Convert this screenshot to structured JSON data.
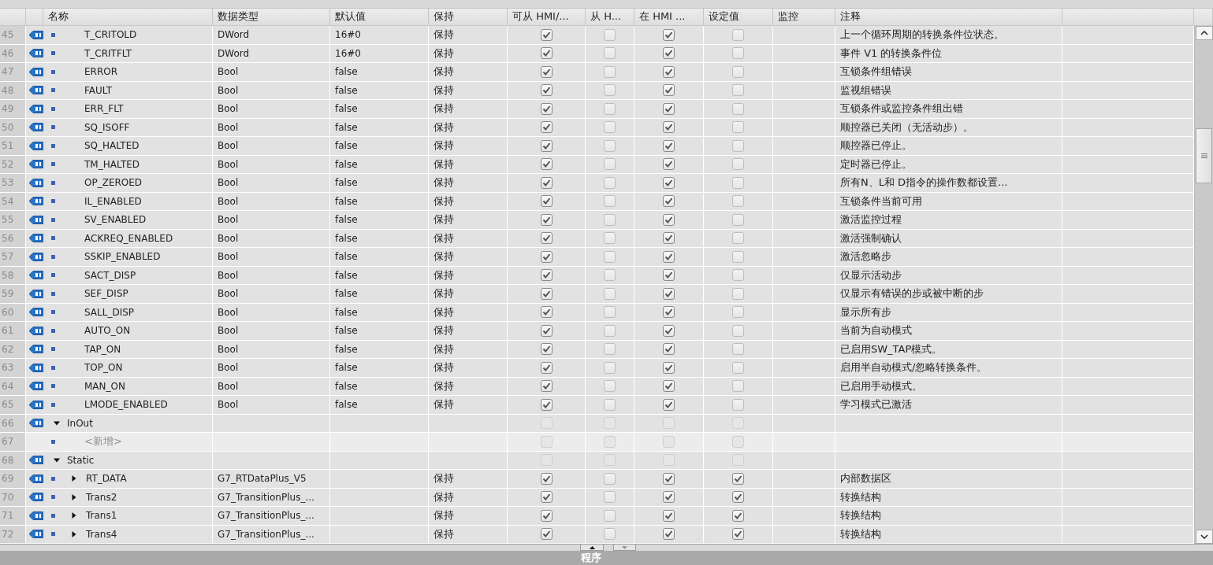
{
  "columns": [
    "名称",
    "数据类型",
    "默认值",
    "保持",
    "可从 HMI/...",
    "从 H...",
    "在 HMI ...",
    "设定值",
    "监控",
    "注释"
  ],
  "rows": [
    {
      "num": "45",
      "kind": "member",
      "name": "T_CRITOLD",
      "type": "DWord",
      "default": "16#0",
      "retain": "保持",
      "checks": [
        true,
        false,
        true,
        false
      ],
      "disabled": false,
      "comment": "上一个循环周期的转换条件位状态。"
    },
    {
      "num": "46",
      "kind": "member",
      "name": "T_CRITFLT",
      "type": "DWord",
      "default": "16#0",
      "retain": "保持",
      "checks": [
        true,
        false,
        true,
        false
      ],
      "disabled": false,
      "comment": "事件 V1 的转换条件位"
    },
    {
      "num": "47",
      "kind": "member",
      "name": "ERROR",
      "type": "Bool",
      "default": "false",
      "retain": "保持",
      "checks": [
        true,
        false,
        true,
        false
      ],
      "disabled": false,
      "comment": "互锁条件组错误"
    },
    {
      "num": "48",
      "kind": "member",
      "name": "FAULT",
      "type": "Bool",
      "default": "false",
      "retain": "保持",
      "checks": [
        true,
        false,
        true,
        false
      ],
      "disabled": false,
      "comment": "监视组错误"
    },
    {
      "num": "49",
      "kind": "member",
      "name": "ERR_FLT",
      "type": "Bool",
      "default": "false",
      "retain": "保持",
      "checks": [
        true,
        false,
        true,
        false
      ],
      "disabled": false,
      "comment": "互锁条件或监控条件组出错"
    },
    {
      "num": "50",
      "kind": "member",
      "name": "SQ_ISOFF",
      "type": "Bool",
      "default": "false",
      "retain": "保持",
      "checks": [
        true,
        false,
        true,
        false
      ],
      "disabled": false,
      "comment": "顺控器已关闭（无活动步）。"
    },
    {
      "num": "51",
      "kind": "member",
      "name": "SQ_HALTED",
      "type": "Bool",
      "default": "false",
      "retain": "保持",
      "checks": [
        true,
        false,
        true,
        false
      ],
      "disabled": false,
      "comment": "顺控器已停止。"
    },
    {
      "num": "52",
      "kind": "member",
      "name": "TM_HALTED",
      "type": "Bool",
      "default": "false",
      "retain": "保持",
      "checks": [
        true,
        false,
        true,
        false
      ],
      "disabled": false,
      "comment": "定时器已停止。"
    },
    {
      "num": "53",
      "kind": "member",
      "name": "OP_ZEROED",
      "type": "Bool",
      "default": "false",
      "retain": "保持",
      "checks": [
        true,
        false,
        true,
        false
      ],
      "disabled": false,
      "comment": "所有N、L和 D指令的操作数都设置..."
    },
    {
      "num": "54",
      "kind": "member",
      "name": "IL_ENABLED",
      "type": "Bool",
      "default": "false",
      "retain": "保持",
      "checks": [
        true,
        false,
        true,
        false
      ],
      "disabled": false,
      "comment": "互锁条件当前可用"
    },
    {
      "num": "55",
      "kind": "member",
      "name": "SV_ENABLED",
      "type": "Bool",
      "default": "false",
      "retain": "保持",
      "checks": [
        true,
        false,
        true,
        false
      ],
      "disabled": false,
      "comment": "激活监控过程"
    },
    {
      "num": "56",
      "kind": "member",
      "name": "ACKREQ_ENABLED",
      "type": "Bool",
      "default": "false",
      "retain": "保持",
      "checks": [
        true,
        false,
        true,
        false
      ],
      "disabled": false,
      "comment": "激活强制确认"
    },
    {
      "num": "57",
      "kind": "member",
      "name": "SSKIP_ENABLED",
      "type": "Bool",
      "default": "false",
      "retain": "保持",
      "checks": [
        true,
        false,
        true,
        false
      ],
      "disabled": false,
      "comment": "激活忽略步"
    },
    {
      "num": "58",
      "kind": "member",
      "name": "SACT_DISP",
      "type": "Bool",
      "default": "false",
      "retain": "保持",
      "checks": [
        true,
        false,
        true,
        false
      ],
      "disabled": false,
      "comment": "仅显示活动步"
    },
    {
      "num": "59",
      "kind": "member",
      "name": "SEF_DISP",
      "type": "Bool",
      "default": "false",
      "retain": "保持",
      "checks": [
        true,
        false,
        true,
        false
      ],
      "disabled": false,
      "comment": "仅显示有错误的步或被中断的步"
    },
    {
      "num": "60",
      "kind": "member",
      "name": "SALL_DISP",
      "type": "Bool",
      "default": "false",
      "retain": "保持",
      "checks": [
        true,
        false,
        true,
        false
      ],
      "disabled": false,
      "comment": "显示所有步"
    },
    {
      "num": "61",
      "kind": "member",
      "name": "AUTO_ON",
      "type": "Bool",
      "default": "false",
      "retain": "保持",
      "checks": [
        true,
        false,
        true,
        false
      ],
      "disabled": false,
      "comment": "当前为自动模式"
    },
    {
      "num": "62",
      "kind": "member",
      "name": "TAP_ON",
      "type": "Bool",
      "default": "false",
      "retain": "保持",
      "checks": [
        true,
        false,
        true,
        false
      ],
      "disabled": false,
      "comment": "已启用SW_TAP模式。"
    },
    {
      "num": "63",
      "kind": "member",
      "name": "TOP_ON",
      "type": "Bool",
      "default": "false",
      "retain": "保持",
      "checks": [
        true,
        false,
        true,
        false
      ],
      "disabled": false,
      "comment": "启用半自动模式/忽略转换条件。"
    },
    {
      "num": "64",
      "kind": "member",
      "name": "MAN_ON",
      "type": "Bool",
      "default": "false",
      "retain": "保持",
      "checks": [
        true,
        false,
        true,
        false
      ],
      "disabled": false,
      "comment": "已启用手动模式。"
    },
    {
      "num": "65",
      "kind": "member",
      "name": "LMODE_ENABLED",
      "type": "Bool",
      "default": "false",
      "retain": "保持",
      "checks": [
        true,
        false,
        true,
        false
      ],
      "disabled": false,
      "comment": "学习模式已激活"
    },
    {
      "num": "66",
      "kind": "section",
      "name": "InOut",
      "expanded": true,
      "checks": [
        false,
        false,
        false,
        false
      ],
      "disabled": true
    },
    {
      "num": "67",
      "kind": "add",
      "name": "<新增>",
      "checks": [
        false,
        false,
        false,
        false
      ],
      "disabled": true
    },
    {
      "num": "68",
      "kind": "section",
      "name": "Static",
      "expanded": true,
      "checks": [
        false,
        false,
        false,
        false
      ],
      "disabled": true
    },
    {
      "num": "69",
      "kind": "member",
      "expanded": false,
      "name": "RT_DATA",
      "type": "G7_RTDataPlus_V5",
      "retain": "保持",
      "checks": [
        true,
        false,
        true,
        true
      ],
      "disabled": false,
      "comment": "内部数据区"
    },
    {
      "num": "70",
      "kind": "member",
      "expanded": false,
      "name": "Trans2",
      "type": "G7_TransitionPlus_...",
      "retain": "保持",
      "checks": [
        true,
        false,
        true,
        true
      ],
      "disabled": false,
      "comment": "转换结构"
    },
    {
      "num": "71",
      "kind": "member",
      "expanded": false,
      "name": "Trans1",
      "type": "G7_TransitionPlus_...",
      "retain": "保持",
      "checks": [
        true,
        false,
        true,
        true
      ],
      "disabled": false,
      "comment": "转换结构"
    },
    {
      "num": "72",
      "kind": "member",
      "expanded": false,
      "name": "Trans4",
      "type": "G7_TransitionPlus_...",
      "retain": "保持",
      "checks": [
        true,
        false,
        true,
        true
      ],
      "disabled": false,
      "comment": "转换结构"
    }
  ],
  "bottom_bar": {
    "title": "程序"
  }
}
